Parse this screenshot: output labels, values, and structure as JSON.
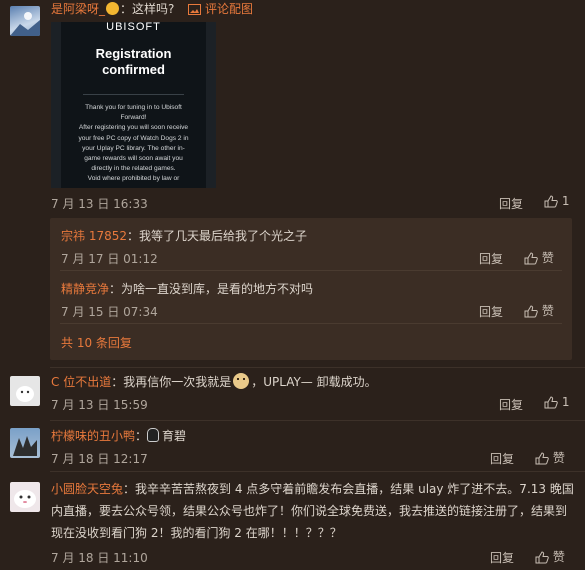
{
  "comments": [
    {
      "username": "是阿梁呀_",
      "text": "：这样吗?",
      "view_image": "评论配图",
      "image": {
        "brand": "UBISOFT",
        "heading": "Registration confirmed",
        "body": "Thank you for tuning in to Ubisoft Forward!\nAfter registering you will soon receive your free PC copy of Watch Dogs 2 in your Uplay PC library. The other in-game rewards will soon await you directly in the related games.\nVoid where prohibited by law or"
      },
      "date": "7 月 13 日 16:33",
      "reply_label": "回复",
      "likes": "1",
      "replies": [
        {
          "username": "宗祎 17852",
          "text": "：我等了几天最后给我了个光之子",
          "date": "7 月 17 日 01:12",
          "reply_label": "回复",
          "like_label": "赞"
        },
        {
          "username": "精静竞净",
          "text": "：为啥一直没到库，是看的地方不对吗",
          "date": "7 月 15 日 07:34",
          "reply_label": "回复",
          "like_label": "赞"
        }
      ],
      "more_replies": "共 10 条回复"
    },
    {
      "username": "C 位不出道",
      "text_before": "：我再信你一次我就是",
      "text_after": "，UPLAY— 卸载成功。",
      "date": "7 月 13 日 15:59",
      "reply_label": "回复",
      "likes": "1"
    },
    {
      "username": "柠檬味的丑小鸭",
      "text": "：育碧",
      "date": "7 月 18 日 12:17",
      "reply_label": "回复",
      "like_label": "赞"
    },
    {
      "username": "小圆脸天空兔",
      "text_line1": "：我辛辛苦苦熬夜到 4 点多守着前瞻发布会直播，结果 ulay 炸了进不去。7.13 晚国",
      "text_line2": "内直播，要去公众号领，结果公众号也炸了！你们说全球免费送，我去推送的链接注册了，结果到",
      "text_line3": "现在没收到看门狗 2！我的看门狗 2 在哪！！！？？？",
      "date": "7 月 18 日 11:10",
      "reply_label": "回复",
      "like_label": "赞"
    }
  ],
  "colors": {
    "background": "#2b211b",
    "username": "#e8793c",
    "reply_box": "#3b2d24"
  }
}
